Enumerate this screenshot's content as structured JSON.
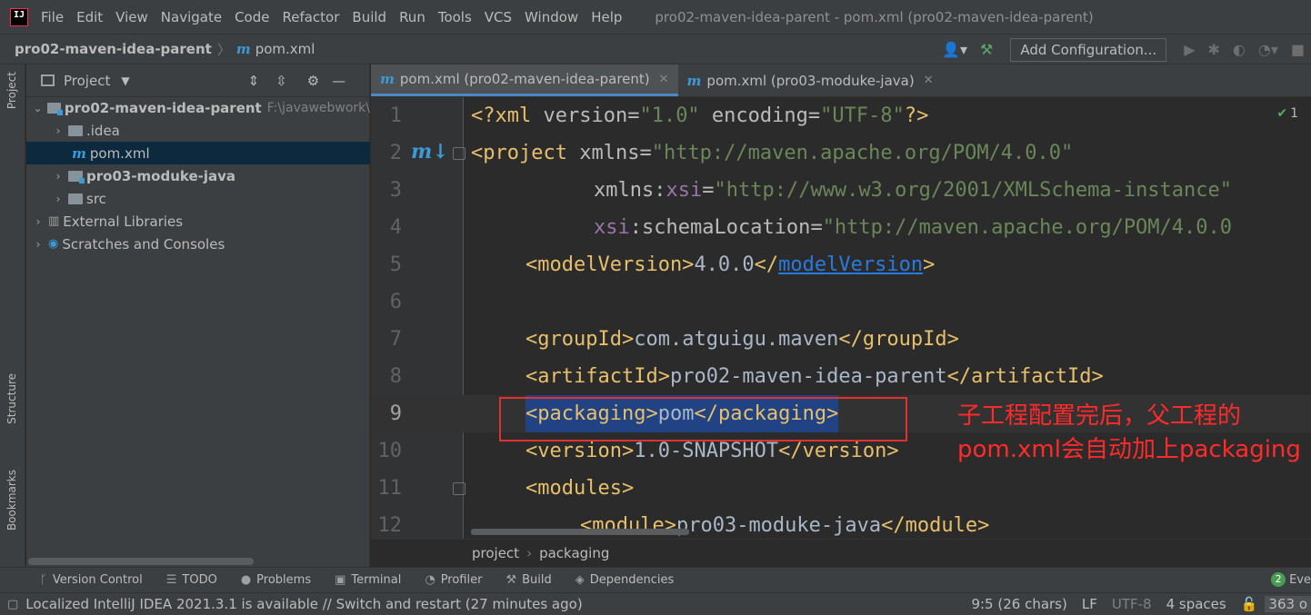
{
  "menubar": {
    "items": [
      "File",
      "Edit",
      "View",
      "Navigate",
      "Code",
      "Refactor",
      "Build",
      "Run",
      "Tools",
      "VCS",
      "Window",
      "Help"
    ],
    "window_title": "pro02-maven-idea-parent - pom.xml (pro02-maven-idea-parent)"
  },
  "navbar": {
    "root": "pro02-maven-idea-parent",
    "file": "pom.xml",
    "add_configuration": "Add Configuration..."
  },
  "left_strip": {
    "project": "Project",
    "structure": "Structure",
    "bookmarks": "Bookmarks"
  },
  "project_panel": {
    "title": "Project",
    "tree": [
      {
        "label": "pro02-maven-idea-parent",
        "path": "F:\\javawebwork\\",
        "bold": true
      },
      {
        "label": ".idea"
      },
      {
        "label": "pom.xml"
      },
      {
        "label": "pro03-moduke-java",
        "bold": true
      },
      {
        "label": "src"
      },
      {
        "label": "External Libraries"
      },
      {
        "label": "Scratches and Consoles"
      }
    ]
  },
  "editor_tabs": [
    {
      "label": "pom.xml (pro02-maven-idea-parent)",
      "active": true
    },
    {
      "label": "pom.xml (pro03-moduke-java)",
      "active": false
    }
  ],
  "editor": {
    "line_numbers": [
      "1",
      "2",
      "3",
      "4",
      "5",
      "6",
      "7",
      "8",
      "9",
      "10",
      "11",
      "12"
    ],
    "inspection_count": "1",
    "annotation": "子工程配置完后，父工程的pom.xml会自动加上packaging",
    "code": {
      "l1": {
        "a": "<?xml ",
        "b": "version",
        "c": "=",
        "d": "\"1.0\"",
        "e": " encoding",
        "f": "=",
        "g": "\"UTF-8\"",
        "h": "?>"
      },
      "l2": {
        "a": "<project ",
        "b": "xmlns",
        "c": "=",
        "d": "\"http://maven.apache.org/POM/4.0.0\""
      },
      "l3": {
        "a": "xmlns:",
        "b": "xsi",
        "c": "=",
        "d": "\"http://www.w3.org/2001/XMLSchema-instance\""
      },
      "l4": {
        "a": "xsi",
        "b": ":schemaLocation",
        "c": "=",
        "d": "\"http://maven.apache.org/POM/4.0.0"
      },
      "l5": {
        "a": "<modelVersion>",
        "b": "4.0.0",
        "c": "</",
        "d": "modelVersion",
        "e": ">"
      },
      "l7": {
        "a": "<groupId>",
        "b": "com.atguigu.maven",
        "c": "</groupId>"
      },
      "l8": {
        "a": "<artifactId>",
        "b": "pro02-maven-idea-parent",
        "c": "</artifactId>"
      },
      "l9": {
        "a": "<packaging>",
        "b": "pom",
        "c": "</packaging>"
      },
      "l10": {
        "a": "<version>",
        "b": "1.0-SNAPSHOT",
        "c": "</version>"
      },
      "l11": {
        "a": "<modules>"
      },
      "l12": {
        "a": "<module>",
        "b": "pro03-moduke-java",
        "c": "</module>"
      }
    }
  },
  "breadcrumb": [
    "project",
    "packaging"
  ],
  "tool_tabs": [
    "Version Control",
    "TODO",
    "Problems",
    "Terminal",
    "Profiler",
    "Build",
    "Dependencies"
  ],
  "event_log": {
    "count": "2",
    "label": "Eve"
  },
  "statusbar": {
    "message": "Localized IntelliJ IDEA 2021.3.1 is available // Switch and restart (27 minutes ago)",
    "position": "9:5 (26 chars)",
    "line_sep": "LF",
    "encoding": "UTF-8",
    "indent": "4 spaces",
    "memory": "363 o"
  }
}
